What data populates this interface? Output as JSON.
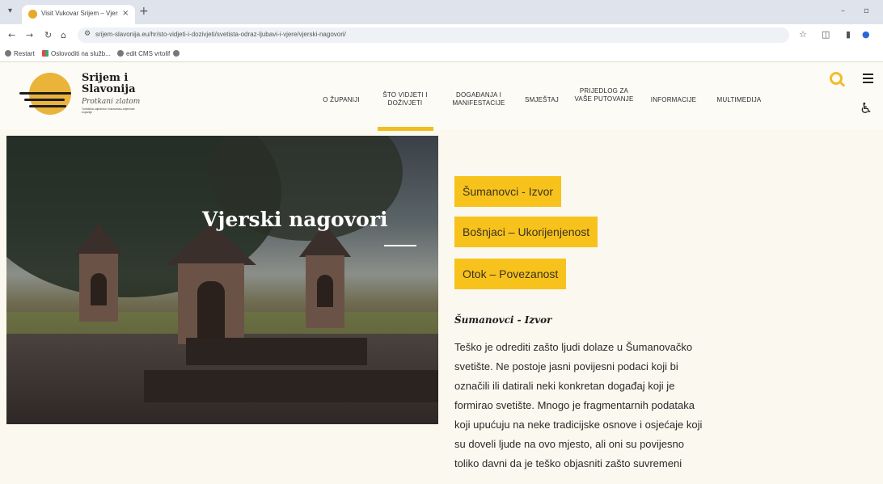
{
  "browser": {
    "tab_title": "Visit Vukovar Srijem – Vjerski n",
    "tab_close": "×",
    "new_tab": "+",
    "url": "srijem-slavonija.eu/hr/sto-vidjeti-i-dozivjeti/svetista-odraz-ljubavi-i-vjere/vjerski-nagovori/",
    "bookmarks": [
      "Restart",
      "Oslovoditi na služb...",
      "edit CMS vrtolif"
    ]
  },
  "site": {
    "logo_title": "Srijem i Slavonija",
    "logo_tagline": "Protkani zlatom",
    "logo_small": "Turistička zajednica Vukovarsko-srijemske županije",
    "menu": [
      "O županiji",
      "Što vidjeti i doživjeti",
      "Događanja i manifestacije",
      "Smještaj",
      "Prijedlog za vaše putovanje",
      "Informacije",
      "Multimedija"
    ]
  },
  "hero": {
    "title": "Vjerski nagovori"
  },
  "content": {
    "links": [
      "Šumanovci - Izvor",
      "Bošnjaci – Ukorijenjenost",
      "Otok – Povezanost"
    ],
    "section_title": "Šumanovci - Izvor",
    "paragraph_lines": [
      "Teško je odrediti zašto ljudi dolaze u Šumanovačko",
      "svetište. Ne postoje jasni povijesni podaci koji bi",
      "označili ili datirali neki konkretan događaj koji je",
      "formirao svetište. Mnogo je fragmentarnih podataka",
      "koji upućuju na neke tradicijske osnove i osjećaje koji",
      "su doveli ljude na ovo mjesto, ali oni su povijesno",
      "toliko davni da je teško objasniti zašto suvremeni"
    ]
  },
  "colors": {
    "accent": "#f7c21b",
    "background": "#fbf8ef"
  }
}
